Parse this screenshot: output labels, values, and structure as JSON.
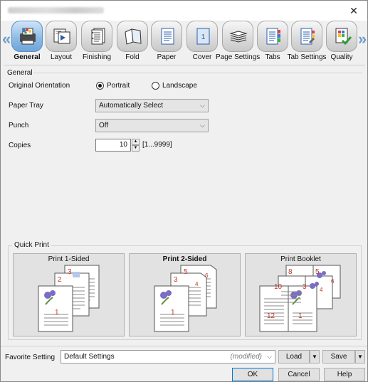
{
  "window": {
    "close_glyph": "✕"
  },
  "tabs": [
    {
      "label": "General",
      "icon": "general-icon",
      "selected": true
    },
    {
      "label": "Layout",
      "icon": "layout-icon"
    },
    {
      "label": "Finishing",
      "icon": "finishing-icon"
    },
    {
      "label": "Fold",
      "icon": "fold-icon"
    },
    {
      "label": "Paper",
      "icon": "paper-icon"
    },
    {
      "label": "Cover",
      "icon": "cover-icon"
    },
    {
      "label": "Page Settings",
      "icon": "page-settings-icon"
    },
    {
      "label": "Tabs",
      "icon": "tabs-icon"
    },
    {
      "label": "Tab Settings",
      "icon": "tab-settings-icon"
    },
    {
      "label": "Quality",
      "icon": "quality-icon"
    }
  ],
  "general": {
    "group_title": "General",
    "orientation_label": "Original Orientation",
    "portrait_label": "Portrait",
    "landscape_label": "Landscape",
    "orientation_selected": "Portrait",
    "paper_tray_label": "Paper Tray",
    "paper_tray_value": "Automatically Select",
    "punch_label": "Punch",
    "punch_value": "Off",
    "copies_label": "Copies",
    "copies_value": "10",
    "copies_range": "[1...9999]"
  },
  "quick_print": {
    "title": "Quick Print",
    "cards": [
      {
        "label": "Print 1-Sided",
        "pages": [
          "3",
          "2",
          "1"
        ]
      },
      {
        "label": "Print 2-Sided",
        "pages": [
          "5",
          "6",
          "3",
          "4",
          "1"
        ]
      },
      {
        "label": "Print Booklet",
        "pages": [
          "8",
          "5",
          "6",
          "10",
          "3",
          "4",
          "12",
          "1"
        ]
      }
    ]
  },
  "footer": {
    "favorite_label": "Favorite Setting",
    "favorite_value": "Default Settings",
    "favorite_modified": "(modified)",
    "load_label": "Load",
    "save_label": "Save",
    "ok_label": "OK",
    "cancel_label": "Cancel",
    "help_label": "Help"
  },
  "colors": {
    "accent": "#0078d7",
    "page_number": "#c0392b",
    "flower": "#7b6cc4",
    "leaf": "#5b8f3a"
  }
}
